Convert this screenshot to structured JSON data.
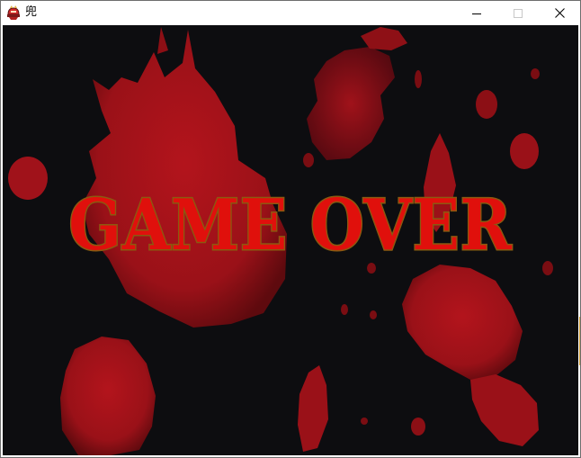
{
  "window": {
    "title": "兜",
    "icon": "helmet-icon"
  },
  "controls": {
    "minimize_icon": "minimize-icon",
    "maximize_icon": "maximize-icon",
    "close_icon": "close-icon"
  },
  "game": {
    "message": "GAME OVER",
    "background": "blood-splatter",
    "colors": {
      "background": "#0d0d10",
      "splatter": "#a8141b",
      "text_fill": "#e0100c",
      "text_outline": "#8a5a10"
    }
  }
}
